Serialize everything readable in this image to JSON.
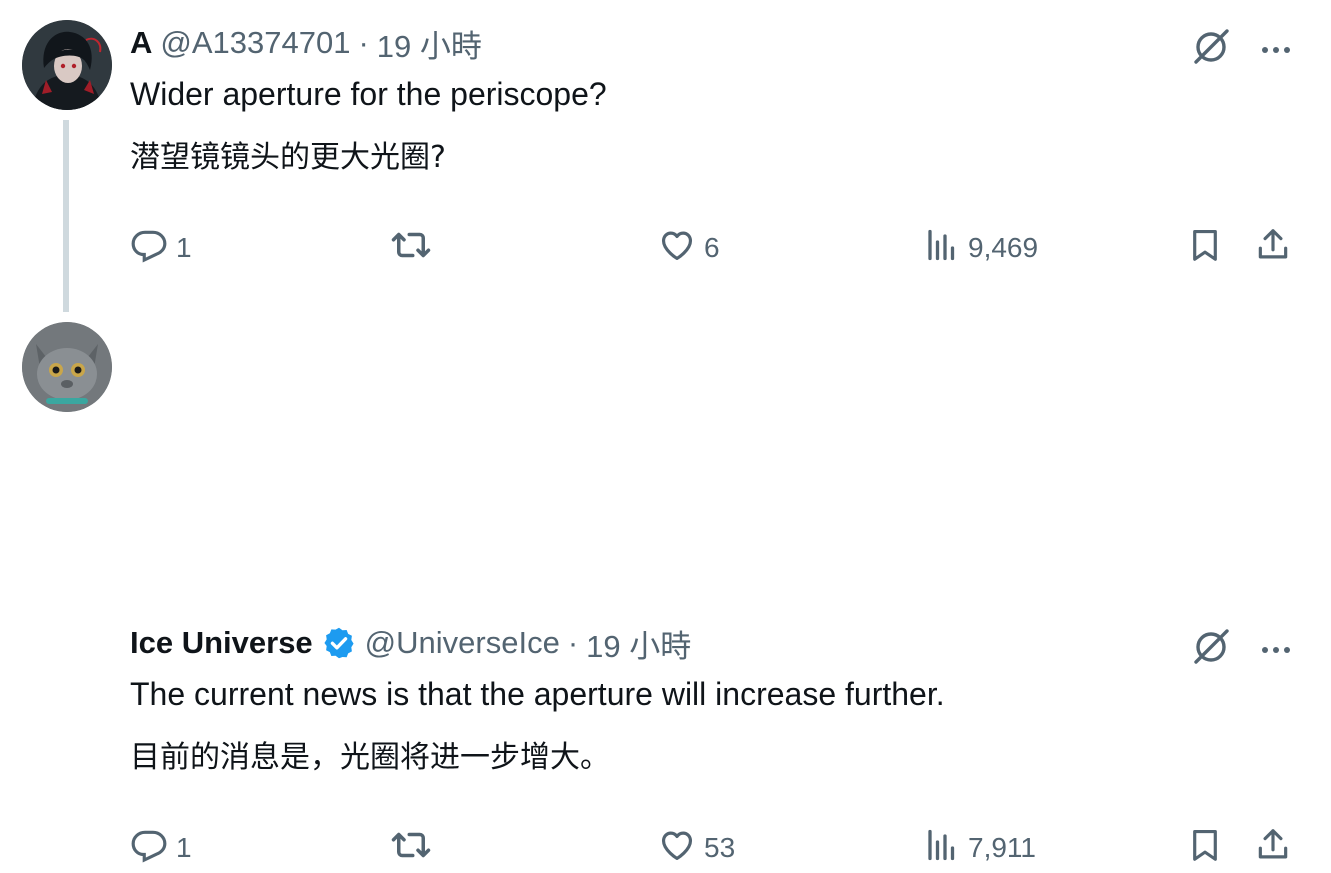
{
  "tweets": [
    {
      "name": "A",
      "handle": "@A13374701",
      "separator": "·",
      "time": "19 小時",
      "text_en": "Wider aperture for the periscope?",
      "text_zh": "潜望镜镜头的更大光圈?",
      "verified": false,
      "actions": {
        "replies": "1",
        "retweets": "",
        "likes": "6",
        "views": "9,469"
      }
    },
    {
      "name": "Ice Universe",
      "handle": "@UniverseIce",
      "separator": "·",
      "time": "19 小時",
      "text_en": "The current news is that the aperture will increase further.",
      "text_zh": "目前的消息是，光圈将进一步增大。",
      "verified": true,
      "actions": {
        "replies": "1",
        "retweets": "",
        "likes": "53",
        "views": "7,911"
      }
    }
  ],
  "colors": {
    "text": "#0f1419",
    "secondary": "#536471",
    "verified": "#1d9bf0",
    "thread_line": "#cfd9de"
  },
  "icons": [
    "reply-icon",
    "retweet-icon",
    "like-icon",
    "views-icon",
    "bookmark-icon",
    "share-icon",
    "grok-icon",
    "more-icon",
    "verified-badge-icon"
  ]
}
